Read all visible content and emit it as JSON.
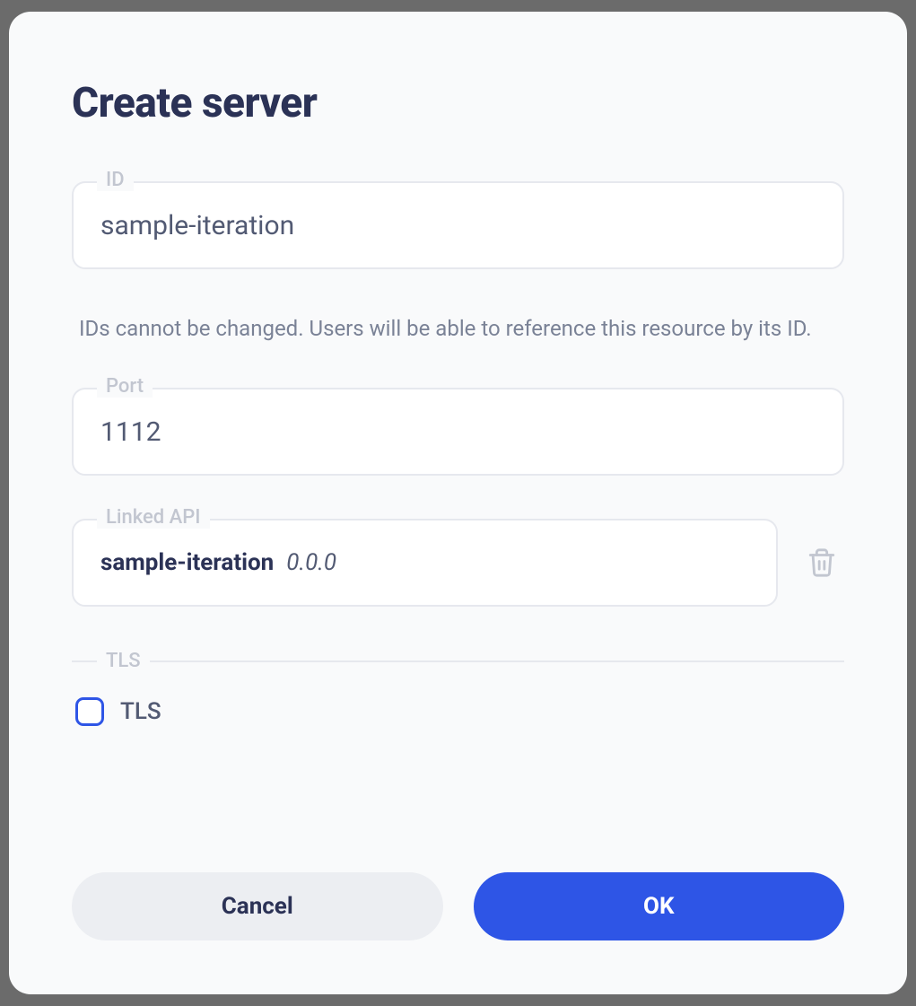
{
  "dialog": {
    "title": "Create server"
  },
  "fields": {
    "id": {
      "label": "ID",
      "value": "sample-iteration",
      "helper": "IDs cannot be changed. Users will be able to reference this resource by its ID."
    },
    "port": {
      "label": "Port",
      "value": "1112"
    },
    "linkedApi": {
      "label": "Linked API",
      "name": "sample-iteration",
      "version": "0.0.0"
    },
    "tls": {
      "sectionLabel": "TLS",
      "checkboxLabel": "TLS",
      "checked": false
    }
  },
  "buttons": {
    "cancel": "Cancel",
    "ok": "OK"
  }
}
